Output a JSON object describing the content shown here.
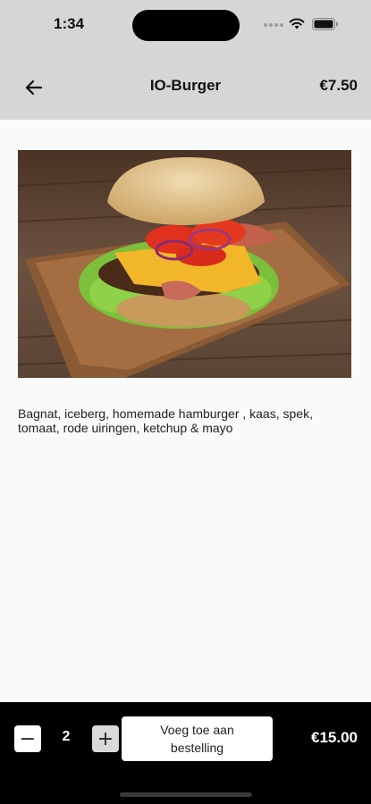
{
  "status_bar": {
    "time": "1:34",
    "icons": [
      "signal-dots-icon",
      "wifi-icon",
      "battery-icon"
    ]
  },
  "header": {
    "back_icon": "arrow-left-icon",
    "title": "IO-Burger",
    "price": "€7.50"
  },
  "product": {
    "image_alt": "burger-photo",
    "description": "Bagnat, iceberg, homemade hamburger , kaas, spek, tomaat, rode uiringen, ketchup & mayo"
  },
  "order_bar": {
    "minus_label": "−",
    "quantity": "2",
    "plus_label": "+",
    "add_button_label": "Voeg toe aan bestelling",
    "total": "€15.00"
  },
  "colors": {
    "header_bg": "#d6d6d6",
    "page_bg": "#fafafa",
    "bottom_bar_bg": "#000000"
  }
}
